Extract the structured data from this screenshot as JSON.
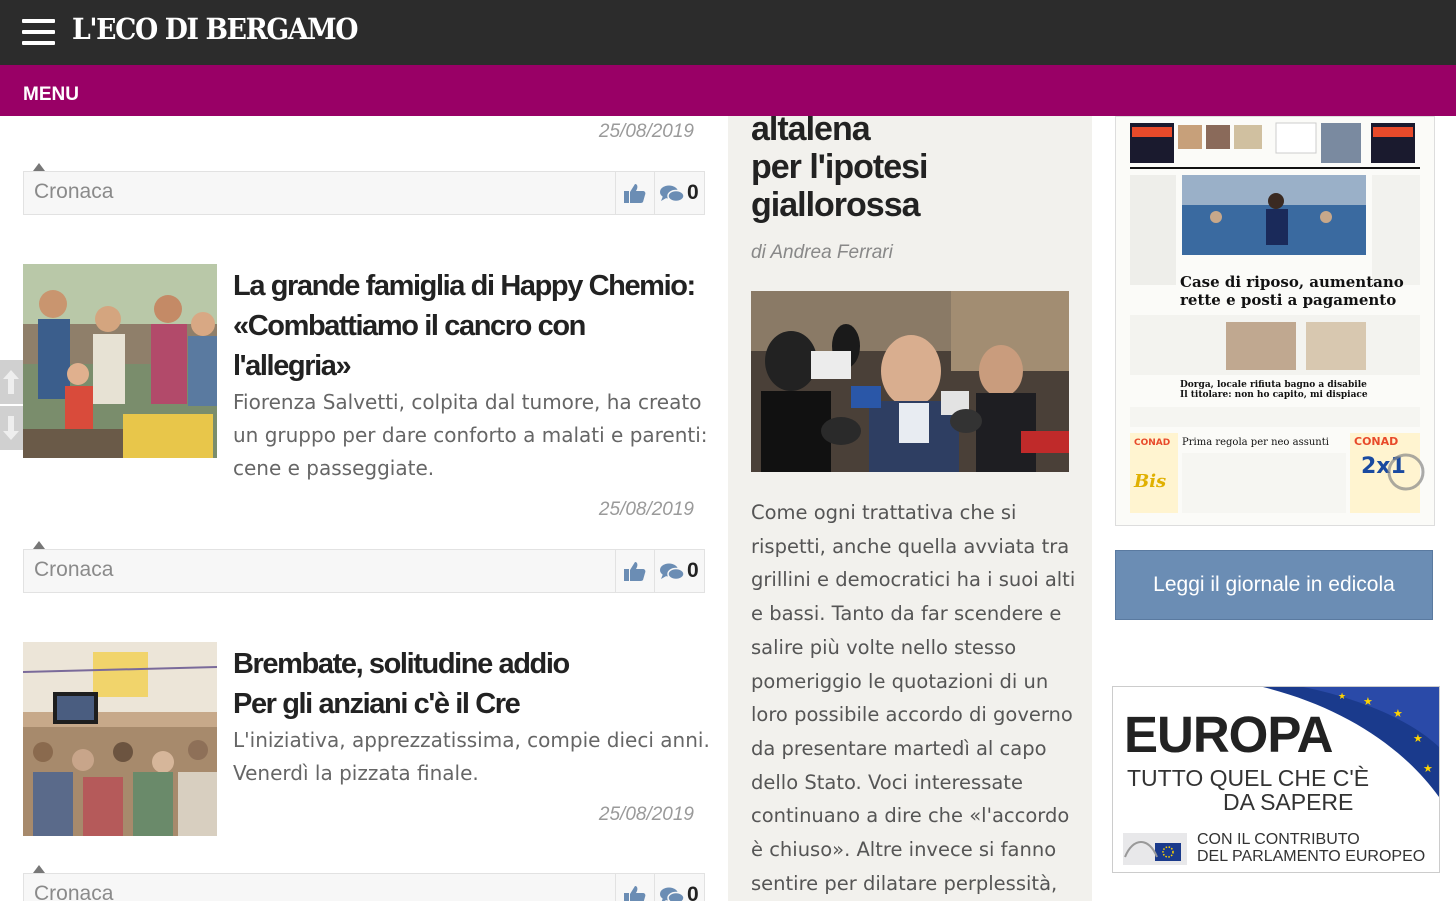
{
  "header": {
    "logo": "L'ECO DI BERGAMO",
    "menu_label": "MENU"
  },
  "left_column": {
    "top_date": "25/08/2019",
    "top_category": {
      "label": "Cronaca",
      "comments": "0"
    },
    "articles": [
      {
        "title_line1": "La grande famiglia di Happy Chemio:",
        "title_line2": "«Combattiamo il cancro con",
        "title_line3": "l'allegria»",
        "summary": "Fiorenza Salvetti, colpita dal tumore, ha creato un gruppo per dare conforto a malati e parenti: cene e passeggiate.",
        "date": "25/08/2019",
        "category": "Cronaca",
        "comments": "0"
      },
      {
        "title_line1": "Brembate, solitudine addio",
        "title_line2": "Per gli anziani c'è il Cre",
        "summary": "L'iniziativa, apprezzatissima, compie dieci anni. Venerdì la pizzata finale.",
        "date": "25/08/2019",
        "category": "Cronaca",
        "comments": "0"
      }
    ]
  },
  "middle_column": {
    "headline_line1": "altalena",
    "headline_line2": "per l'ipotesi",
    "headline_line3": "giallorossa",
    "author": "di Andrea Ferrari",
    "body": "Come ogni trattativa che si rispetti, anche quella avviata tra grillini e democratici ha i suoi alti e bassi. Tanto da far scendere e salire più volte nello stesso pomeriggio le quotazioni di un loro possibile accordo di governo da presentare martedì al capo dello Stato. Voci interessate continuano a dire che «l'accordo è chiuso». Altre invece si fanno sentire per dilatare perplessità,"
  },
  "right_column": {
    "read_button": "Leggi il giornale in edicola",
    "ad": {
      "title": "EUROPA",
      "line1": "TUTTO QUEL CHE C'È",
      "line2": "DA SAPERE",
      "line3": "CON IL CONTRIBUTO",
      "line4": "DEL PARLAMENTO EUROPEO"
    }
  },
  "colors": {
    "topbar": "#2c2c2c",
    "menubar": "#990066",
    "button": "#6b8db4",
    "like_icon": "#6b8db4"
  }
}
